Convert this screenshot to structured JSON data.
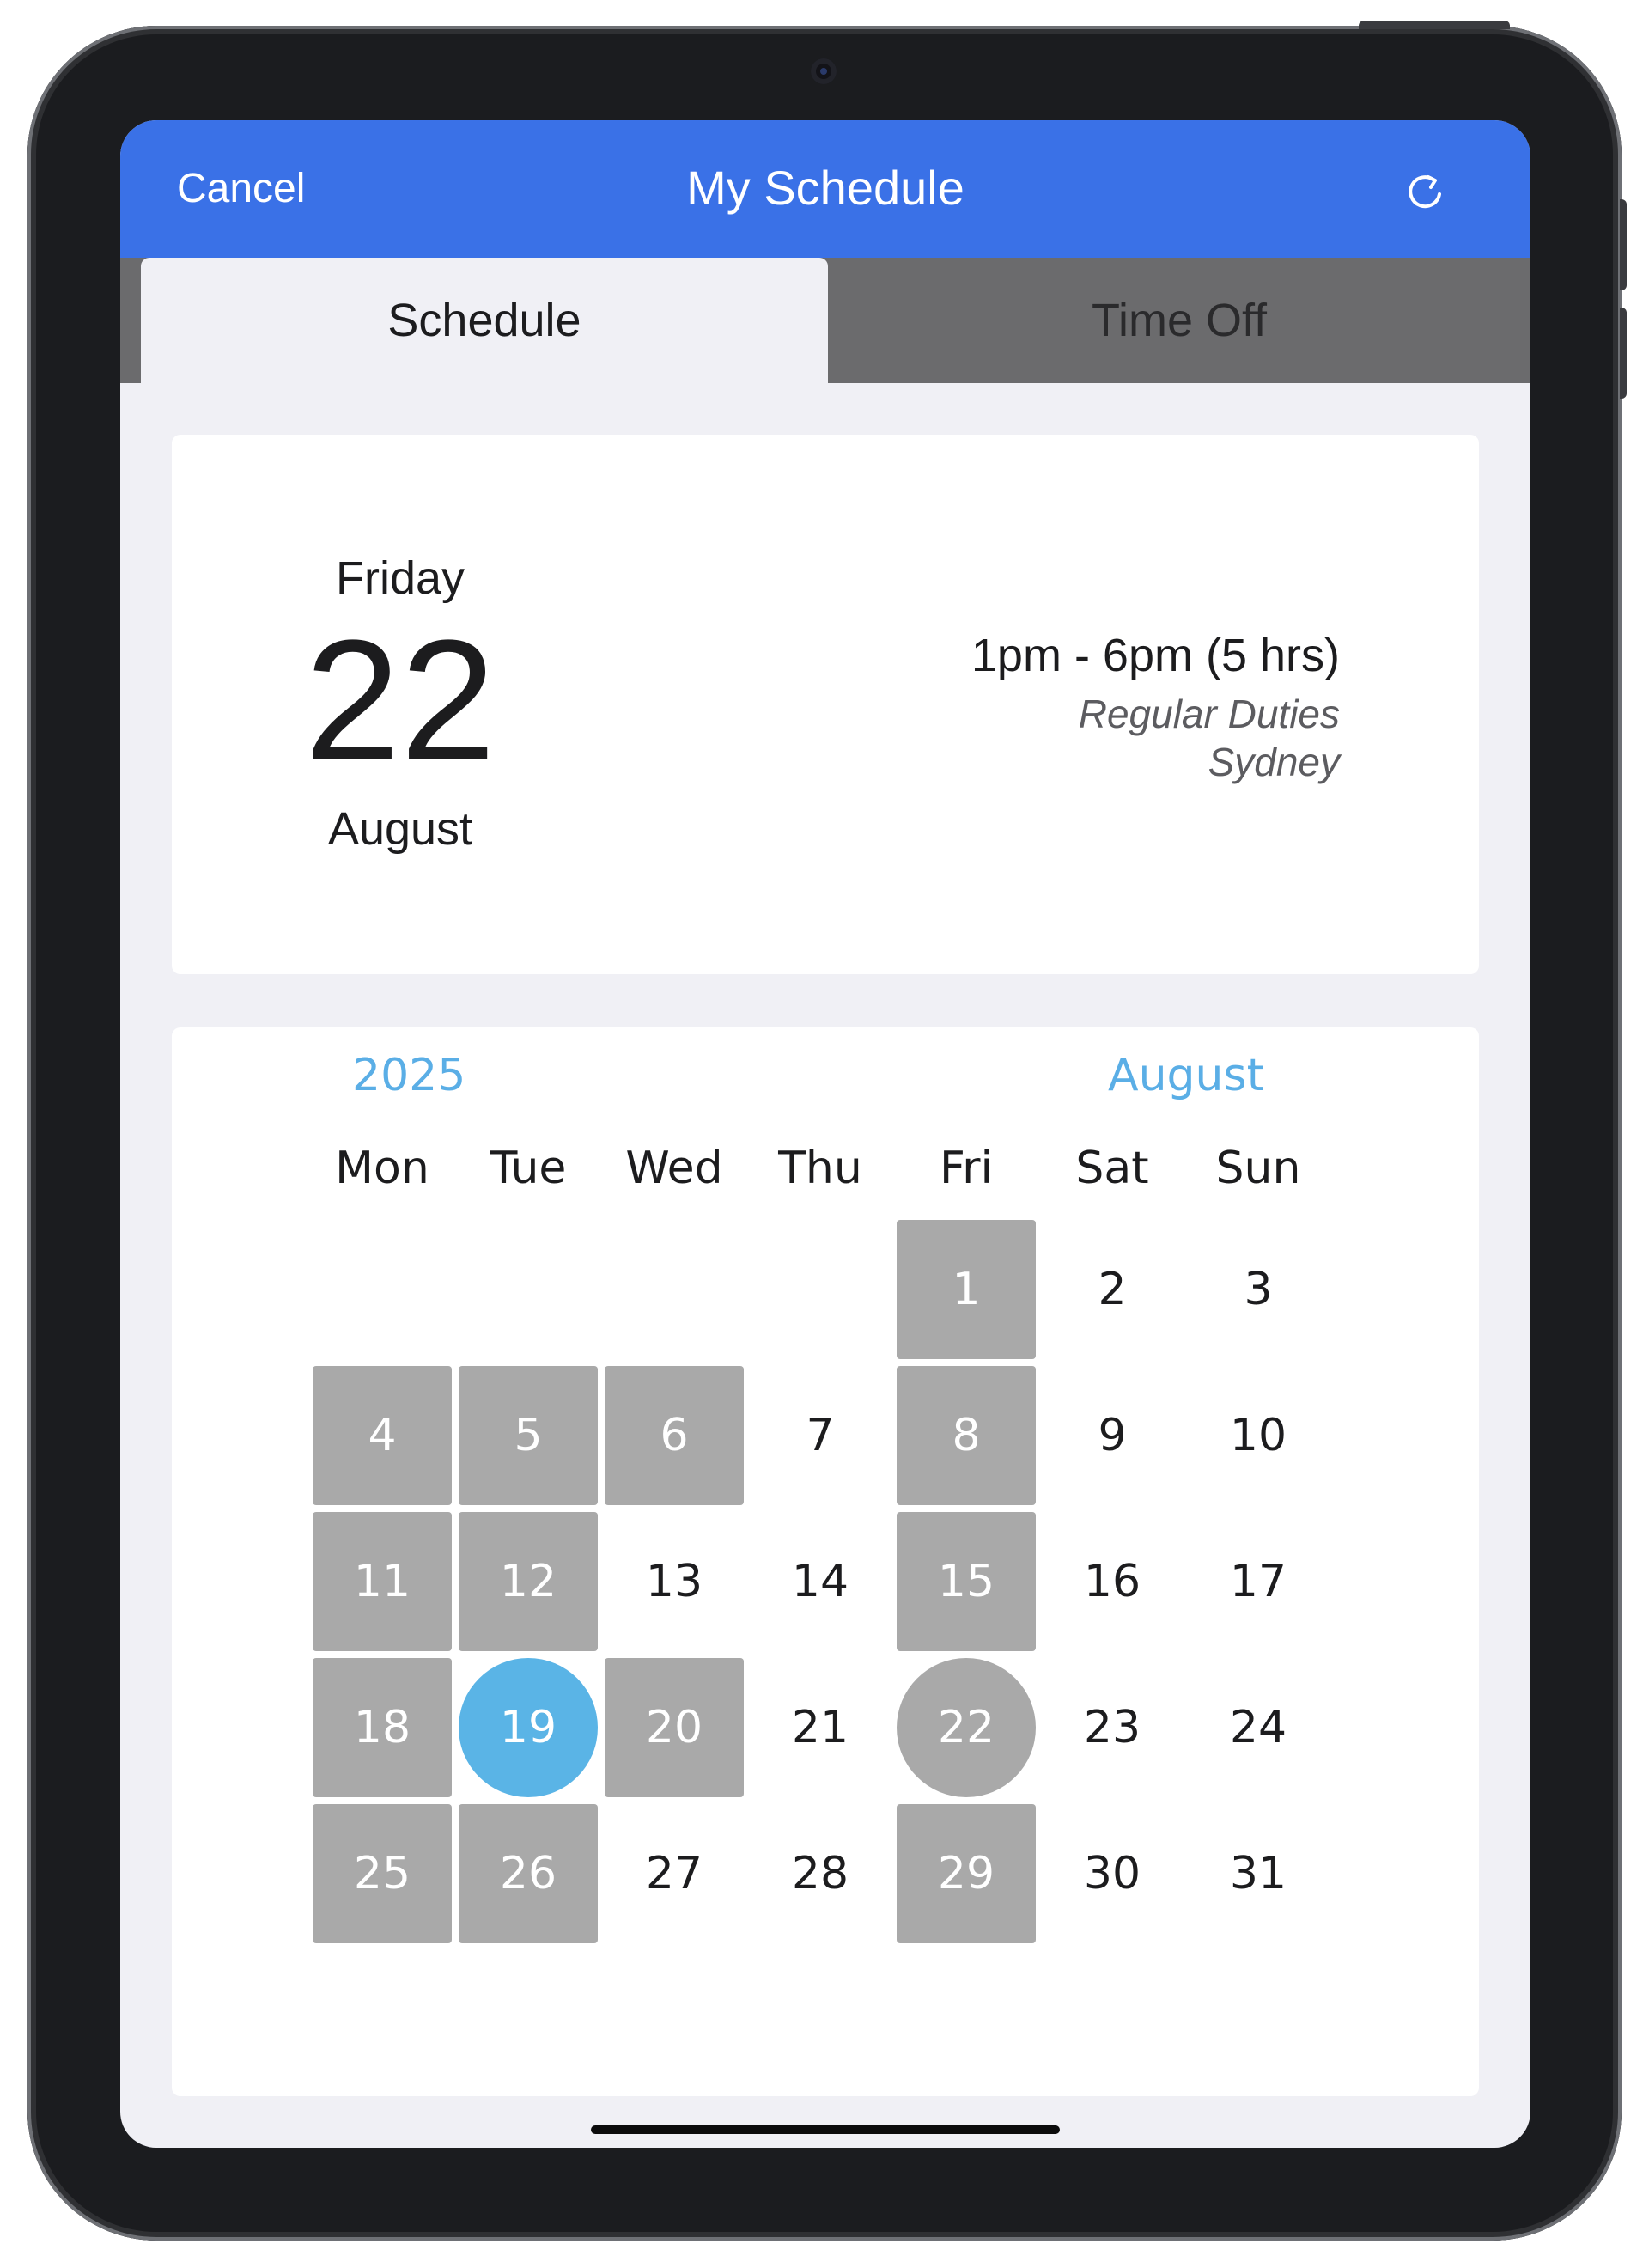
{
  "nav": {
    "cancel_label": "Cancel",
    "title": "My Schedule",
    "refresh_icon": "refresh-icon"
  },
  "tabs": [
    {
      "label": "Schedule",
      "selected": true
    },
    {
      "label": "Time Off",
      "selected": false
    }
  ],
  "shift": {
    "day_name": "Friday",
    "day_number": "22",
    "month": "August",
    "time": "1pm - 6pm (5 hrs)",
    "role": "Regular Duties",
    "location": "Sydney"
  },
  "calendar": {
    "year": "2025",
    "month": "August",
    "weekdays": [
      "Mon",
      "Tue",
      "Wed",
      "Thu",
      "Fri",
      "Sat",
      "Sun"
    ],
    "first_weekday_index": 4,
    "days_in_month": 31,
    "shift_days": [
      1,
      4,
      5,
      6,
      8,
      11,
      12,
      15,
      18,
      20,
      25,
      26,
      29
    ],
    "today": 19,
    "selected": 22,
    "colors": {
      "header_accent": "#5aaee6",
      "shift_day": "#a9a9a9",
      "today": "#5ab4e6",
      "nav_bar": "#3a71e7",
      "tab_bar": "#6b6b6d"
    }
  }
}
